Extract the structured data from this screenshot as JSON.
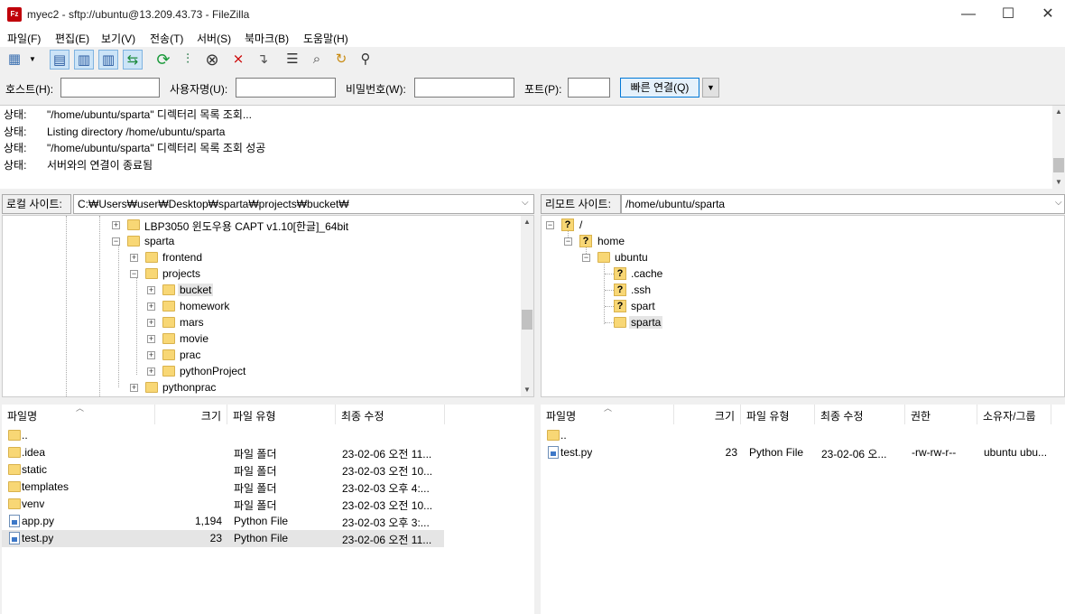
{
  "window": {
    "title": "myec2 - sftp://ubuntu@13.209.43.73 - FileZilla",
    "app_icon_letter": "Fz",
    "minimize": "—",
    "maximize": "☐",
    "close": "✕"
  },
  "menu": [
    "파일(F)",
    "편집(E)",
    "보기(V)",
    "전송(T)",
    "서버(S)",
    "북마크(B)",
    "도움말(H)"
  ],
  "toolbar_icons": [
    "site-manager-icon",
    "dropdown-arrow-icon",
    "toggle-log-icon",
    "toggle-local-tree-icon",
    "toggle-remote-tree-icon",
    "toggle-queue-icon",
    "refresh-icon",
    "process-queue-icon",
    "cancel-icon",
    "disconnect-icon",
    "reconnect-icon",
    "directory-listing-filter-icon",
    "toggle-dir-comparison-icon",
    "sync-browsing-icon",
    "search-icon"
  ],
  "quickconnect": {
    "host_label": "호스트(H):",
    "user_label": "사용자명(U):",
    "pass_label": "비밀번호(W):",
    "port_label": "포트(P):",
    "connect_label": "빠른 연결(Q)",
    "arrow": "▼"
  },
  "log": [
    {
      "label": "상태:",
      "text": "\"/home/ubuntu/sparta\" 디렉터리 목록 조회..."
    },
    {
      "label": "상태:",
      "text": "Listing directory /home/ubuntu/sparta"
    },
    {
      "label": "상태:",
      "text": "\"/home/ubuntu/sparta\" 디렉터리 목록 조회 성공"
    },
    {
      "label": "상태:",
      "text": "서버와의 연결이 종료됨"
    }
  ],
  "local": {
    "label": "로컬 사이트:",
    "path": "C:₩Users₩user₩Desktop₩sparta₩projects₩bucket₩",
    "tree": [
      "LBP3050 윈도우용 CAPT v1.10[한글]_64bit",
      "sparta",
      "frontend",
      "projects",
      "bucket",
      "homework",
      "mars",
      "movie",
      "prac",
      "pythonProject",
      "pythonprac"
    ],
    "columns": [
      "파일명",
      "크기",
      "파일 유형",
      "최종 수정"
    ],
    "files": [
      {
        "name": "..",
        "size": "",
        "type": "",
        "modified": ""
      },
      {
        "name": ".idea",
        "size": "",
        "type": "파일 폴더",
        "modified": "23-02-06 오전 11..."
      },
      {
        "name": "static",
        "size": "",
        "type": "파일 폴더",
        "modified": "23-02-03 오전 10..."
      },
      {
        "name": "templates",
        "size": "",
        "type": "파일 폴더",
        "modified": "23-02-03 오후 4:..."
      },
      {
        "name": "venv",
        "size": "",
        "type": "파일 폴더",
        "modified": "23-02-03 오전 10..."
      },
      {
        "name": "app.py",
        "size": "1,194",
        "type": "Python File",
        "modified": "23-02-03 오후 3:..."
      },
      {
        "name": "test.py",
        "size": "23",
        "type": "Python File",
        "modified": "23-02-06 오전 11..."
      }
    ]
  },
  "remote": {
    "label": "리모트 사이트:",
    "path": "/home/ubuntu/sparta",
    "tree": [
      "/",
      "home",
      "ubuntu",
      ".cache",
      ".ssh",
      "spart",
      "sparta"
    ],
    "columns": [
      "파일명",
      "크기",
      "파일 유형",
      "최종 수정",
      "권한",
      "소유자/그룹"
    ],
    "files": [
      {
        "name": "..",
        "size": "",
        "type": "",
        "modified": "",
        "perm": "",
        "owner": ""
      },
      {
        "name": "test.py",
        "size": "23",
        "type": "Python File",
        "modified": "23-02-06 오...",
        "perm": "-rw-rw-r--",
        "owner": "ubuntu ubu..."
      }
    ]
  },
  "glyphs": {
    "expand": "+",
    "collapse": "−",
    "unknown": "?",
    "sort": "︿",
    "combo": "⌵",
    "up": "▲",
    "down": "▼"
  }
}
